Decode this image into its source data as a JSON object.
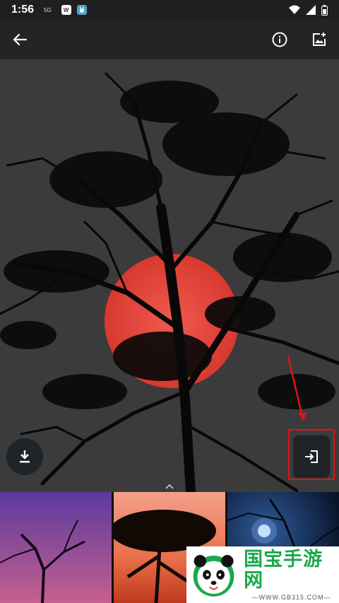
{
  "status_bar": {
    "time": "1:56",
    "network": "5G",
    "app1_letter": "W",
    "app2_letter": ""
  },
  "toolbar": {
    "back_icon": "arrow-left-icon",
    "info_icon": "info-icon",
    "wallpaper_icon": "add-photo-icon"
  },
  "photo": {
    "subject": "silhouette tree red sun"
  },
  "actions": {
    "download_icon": "download-icon",
    "enter_icon": "login-icon"
  },
  "thumbnails": [
    {
      "id": "purple-sky"
    },
    {
      "id": "orange-sunset"
    },
    {
      "id": "blue-moon"
    }
  ],
  "watermark": {
    "brand": "国宝手游网",
    "url": "—WWW.GB315.COM—"
  },
  "colors": {
    "highlight": "#e01414",
    "brand_green": "#19a94c",
    "sun": "#e5453f"
  }
}
